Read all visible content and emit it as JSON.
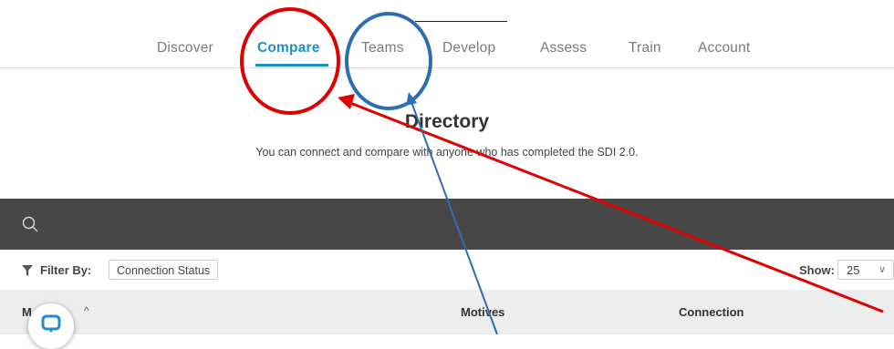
{
  "nav": {
    "items": [
      {
        "label": "Discover",
        "active": false
      },
      {
        "label": "Compare",
        "active": true
      },
      {
        "label": "Teams",
        "active": false
      },
      {
        "label": "Develop",
        "active": false
      },
      {
        "label": "Assess",
        "active": false
      },
      {
        "label": "Train",
        "active": false
      },
      {
        "label": "Account",
        "active": false
      }
    ]
  },
  "page": {
    "title": "Directory",
    "subtitle": "You can connect and compare with anyone who has completed the SDI 2.0."
  },
  "search": {
    "icon": "search-icon"
  },
  "filter": {
    "label": "Filter By:",
    "chip": "Connection Status",
    "icon": "filter-icon"
  },
  "show": {
    "label": "Show:",
    "value": "25"
  },
  "table": {
    "columns": [
      "M",
      "Motives",
      "Connection"
    ]
  },
  "colors": {
    "accent": "#1f8fc9",
    "search_bar": "#474747",
    "header_bg": "#ededed",
    "annotation_red": "#e00000",
    "annotation_blue": "#2e6db4"
  }
}
